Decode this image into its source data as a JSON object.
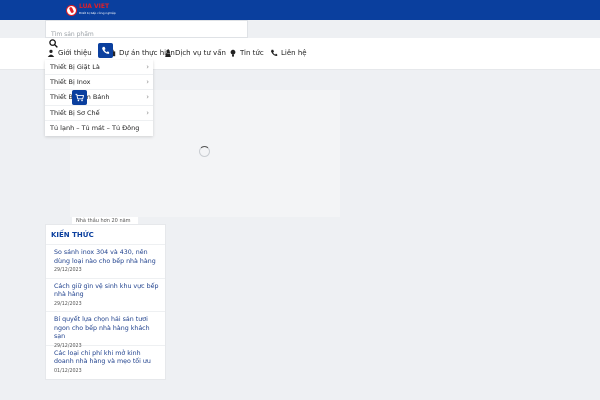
{
  "header": {
    "logo": {
      "name": "LUA VIET",
      "slogan": "thiết bị bếp công nghiệp"
    }
  },
  "search": {
    "placeholder": "Tìm sản phẩm"
  },
  "nav": {
    "items": [
      {
        "label": "Giới thiệu",
        "icon": "person-icon"
      },
      {
        "label": "Dự án thực hiện",
        "icon": "briefcase-icon"
      },
      {
        "label": "Dịch vụ tư vấn",
        "icon": "user-tie-icon"
      },
      {
        "label": "Tin tức",
        "icon": "lightbulb-icon"
      },
      {
        "label": "Liên hệ",
        "icon": "phone-icon"
      }
    ]
  },
  "dropdown": {
    "items": [
      {
        "label": "Thiết Bị Giặt Là",
        "has_submenu": true
      },
      {
        "label": "Thiết Bị Inox",
        "has_submenu": true
      },
      {
        "label": "Thiết Bị Làm Bánh",
        "has_submenu": true
      },
      {
        "label": "Thiết Bị Sơ Chế",
        "has_submenu": true
      },
      {
        "label": "Tủ lạnh – Tủ mát – Tủ Đông",
        "has_submenu": false
      }
    ]
  },
  "content": {
    "caption": "Nhà thầu hơn 20 năm"
  },
  "widget": {
    "title": "KIẾN THỨC",
    "posts": [
      {
        "title": "So sánh inox 304 và 430, nên dùng loại nào cho bếp nhà hàng",
        "date": "29/12/2023"
      },
      {
        "title": "Cách giữ gìn vệ sinh khu vực bếp nhà hàng",
        "date": "29/12/2023"
      },
      {
        "title": "Bí quyết lựa chọn hải sản tươi ngon cho bếp nhà hàng khách sạn",
        "date": "29/12/2023"
      },
      {
        "title": "Các loại chi phí khi mở kinh doanh nhà hàng và mẹo tối ưu",
        "date": "01/12/2023"
      }
    ]
  },
  "colors": {
    "brand": "#0a3f9e",
    "logo_red": "#e21f26",
    "link": "#1d3f8c"
  }
}
